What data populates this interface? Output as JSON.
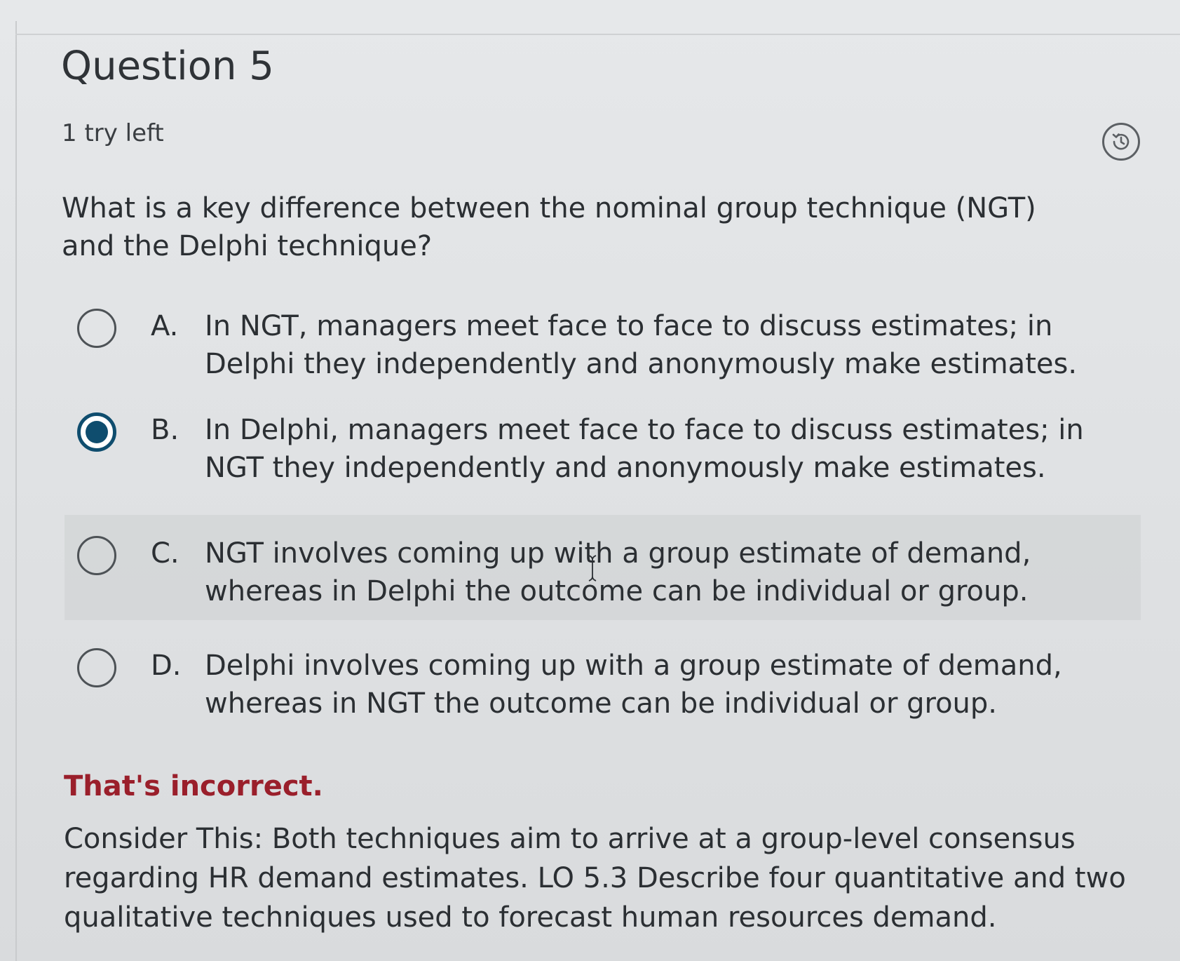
{
  "question": {
    "title": "Question 5",
    "tries_left": "1 try left",
    "prompt": "What is a key difference between the nominal group technique (NGT) and the Delphi technique?"
  },
  "options": [
    {
      "letter": "A.",
      "text": "In NGT, managers meet face to face to discuss estimates; in Delphi they independently and anonymously make estimates.",
      "selected": false
    },
    {
      "letter": "B.",
      "text": "In Delphi, managers meet face to face to discuss estimates; in NGT they independently and anonymously make estimates.",
      "selected": true
    },
    {
      "letter": "C.",
      "text": "NGT involves coming up with a group estimate of demand, whereas in Delphi the outcome can be individual or group.",
      "selected": false
    },
    {
      "letter": "D.",
      "text": "Delphi involves coming up with a group estimate of demand, whereas in NGT the outcome can be individual or group.",
      "selected": false
    }
  ],
  "feedback": {
    "status": "That's incorrect.",
    "explanation": "Consider This: Both techniques aim to arrive at a group-level consensus regarding HR demand estimates. LO 5.3 Describe four quantitative and two qualitative techniques used to forecast human resources demand."
  },
  "icons": {
    "history": "history-icon"
  },
  "colors": {
    "selected_radio": "#0f4d6e",
    "incorrect": "#9a1f2b",
    "text": "#2b2f33"
  }
}
